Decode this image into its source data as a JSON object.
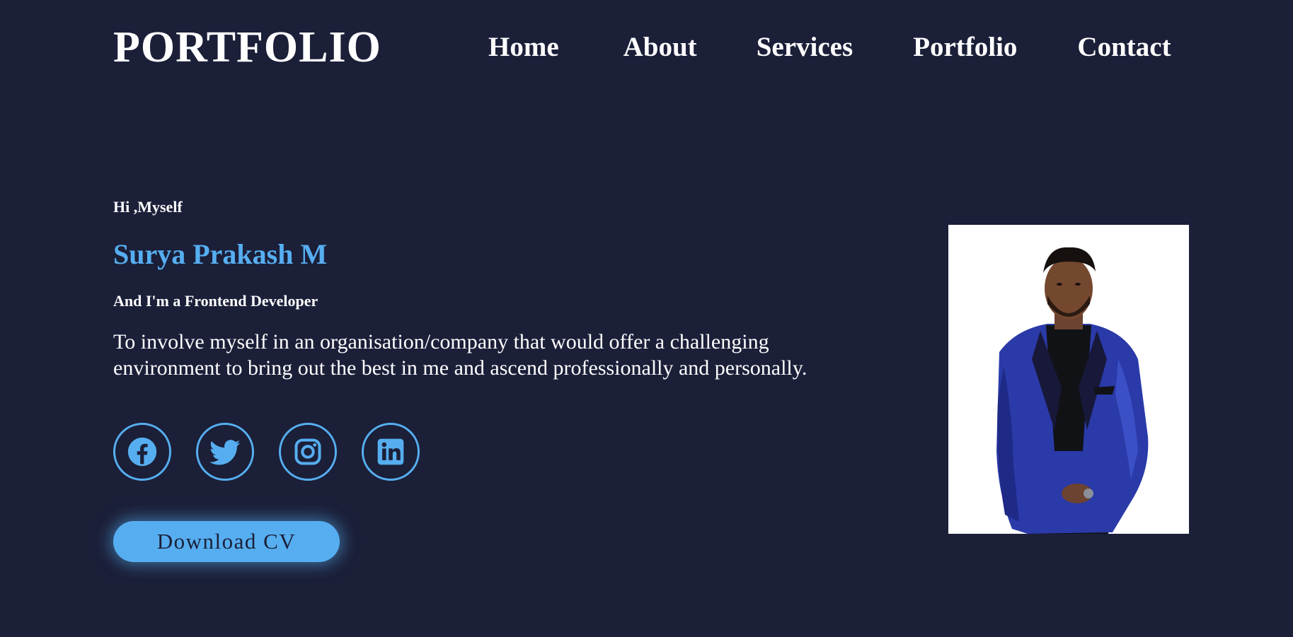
{
  "header": {
    "logo": "PORTFOLIO",
    "nav": {
      "home": "Home",
      "about": "About",
      "services": "Services",
      "portfolio": "Portfolio",
      "contact": "Contact"
    }
  },
  "hero": {
    "greeting": "Hi ,Myself",
    "name": "Surya Prakash M",
    "role": "And I'm a Frontend Developer",
    "objective": "To involve myself in an organisation/company that would offer a challenging environment to bring out the best in me and ascend professionally and personally."
  },
  "social": [
    {
      "icon": "facebook-icon"
    },
    {
      "icon": "twitter-icon"
    },
    {
      "icon": "instagram-icon"
    },
    {
      "icon": "linkedin-icon"
    }
  ],
  "cv_button": {
    "label": "Download CV"
  },
  "colors": {
    "background": "#1b1f38",
    "accent": "#56aef0",
    "text": "#ffffff"
  }
}
